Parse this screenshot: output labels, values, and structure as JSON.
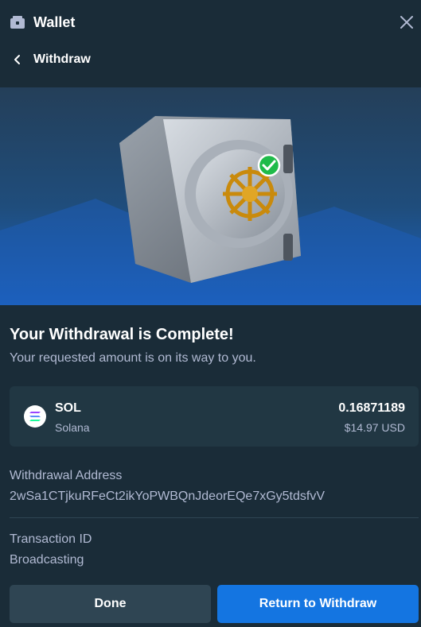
{
  "header": {
    "title": "Wallet",
    "icon": "wallet-icon",
    "close_icon": "close-icon"
  },
  "subheader": {
    "title": "Withdraw",
    "back_icon": "chevron-left-icon"
  },
  "hero": {
    "image": "vault-with-check-icon"
  },
  "status": {
    "title": "Your Withdrawal is Complete!",
    "subtitle": "Your requested amount is on its way to you."
  },
  "asset": {
    "symbol": "SOL",
    "name": "Solana",
    "amount": "0.16871189",
    "usd": "$14.97 USD",
    "icon": "solana-icon"
  },
  "details": {
    "address_label": "Withdrawal Address",
    "address_value": "2wSa1CTjkuRFeCt2ikYoPWBQnJdeorEQe7xGy5tdsfvV",
    "tx_label": "Transaction ID",
    "tx_value": "Broadcasting"
  },
  "buttons": {
    "done": "Done",
    "return": "Return to Withdraw"
  },
  "colors": {
    "accent": "#1475e1",
    "background": "#1a2c38",
    "card": "#213743",
    "muted": "#b1bad3"
  }
}
